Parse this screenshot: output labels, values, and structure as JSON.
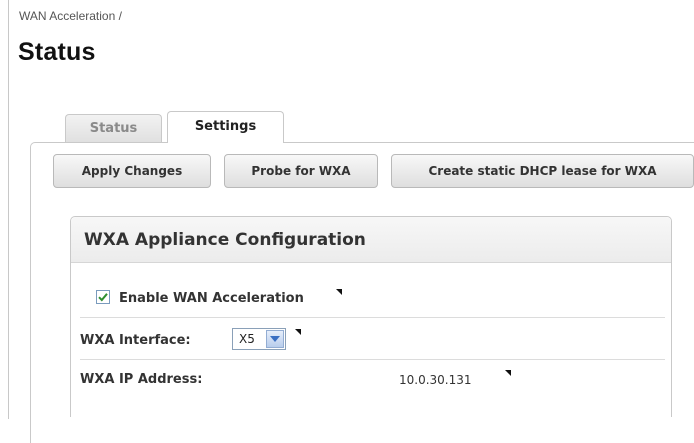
{
  "breadcrumb": "WAN Acceleration /",
  "page_title": "Status",
  "tabs": [
    {
      "label": "Status",
      "active": false
    },
    {
      "label": "Settings",
      "active": true
    }
  ],
  "toolbar": {
    "apply_label": "Apply Changes",
    "probe_label": "Probe for WXA",
    "lease_label": "Create static DHCP lease for WXA"
  },
  "panel": {
    "title": "WXA Appliance Configuration",
    "enable": {
      "label": "Enable WAN Acceleration",
      "checked": true
    },
    "interface": {
      "label": "WXA Interface:",
      "value": "X5"
    },
    "ip": {
      "label": "WXA IP Address:",
      "value": "10.0.30.131"
    }
  },
  "colors": {
    "check": "#2f8f2f",
    "select_accent": "#3a6fc2"
  }
}
